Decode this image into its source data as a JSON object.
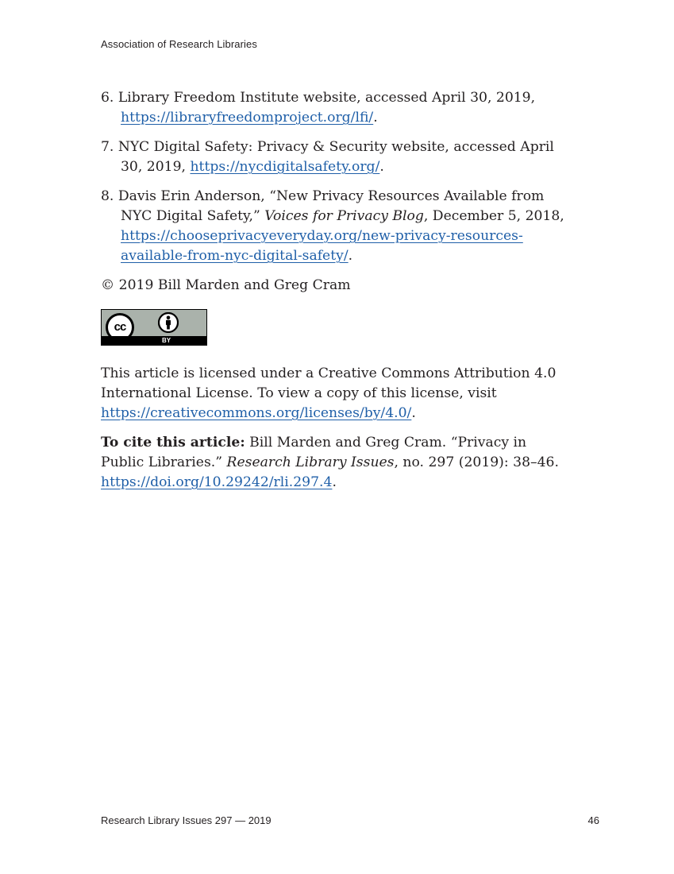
{
  "header": {
    "title": "Association of Research Libraries"
  },
  "notes": [
    {
      "number": "6.",
      "text": "Library Freedom Institute website, accessed April 30, 2019, ",
      "link": "https://libraryfreedomproject.org/lfi/",
      "after": "."
    },
    {
      "number": "7.",
      "text": "NYC Digital Safety: Privacy & Security website, accessed April 30, 2019, ",
      "link": "https://nycdigitalsafety.org/",
      "after": "."
    },
    {
      "number": "8.",
      "text_before_italic": "Davis Erin Anderson, “New Privacy Resources Available from NYC Digital Safety,” ",
      "italic": "Voices for Privacy Blog",
      "text_after_italic": ", December 5, 2018, ",
      "link": "https://chooseprivacyeveryday.org/new-privacy-resources-available-from-nyc-digital-safety/",
      "after": "."
    }
  ],
  "copyright": "© 2019 Bill Marden and Greg Cram",
  "license_badge": {
    "icon_left": "cc-icon",
    "icon_right": "attribution-person-icon",
    "label": "BY",
    "cc_text": "cc"
  },
  "license": {
    "text": "This article is licensed under a Creative Commons Attribution 4.0 International License. To view a copy of this license, visit ",
    "link": "https://creativecommons.org/licenses/by/4.0/",
    "after": "."
  },
  "citation": {
    "label": "To cite this article:",
    "text_before_italic": " Bill Marden and Greg Cram. “Privacy in Public Libraries.” ",
    "italic": "Research Library Issues",
    "text_after_italic": ", no. 297 (2019): 38–46. ",
    "link": "https://doi.org/10.29242/rli.297.4",
    "after": "."
  },
  "footer": {
    "left": "Research Library Issues 297 — 2019",
    "page_number": "46"
  }
}
